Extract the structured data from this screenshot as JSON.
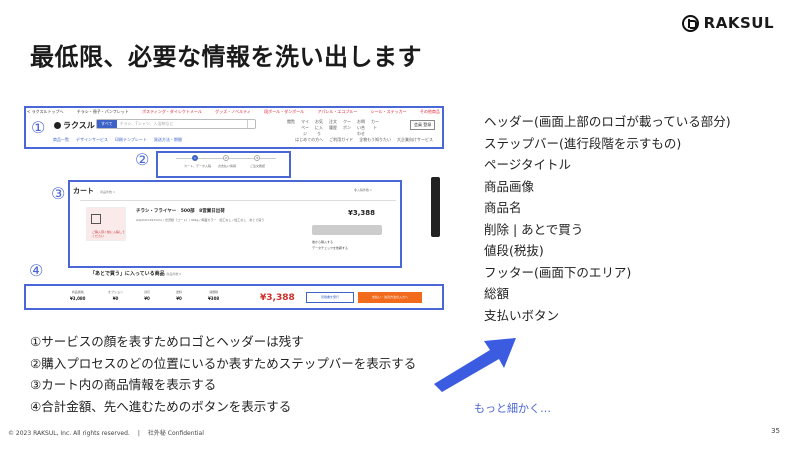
{
  "brand": {
    "name": "RAKSUL"
  },
  "slide": {
    "title": "最低限、必要な情報を洗い出します"
  },
  "mockup": {
    "markers": [
      "①",
      "②",
      "③",
      "④"
    ],
    "topbar_left": "< ラクスルトップへ",
    "topbar_links": [
      "チラシ・冊子・パンフレット",
      "ポスティング・ダイレクトメール",
      "グッズ・ノベルティ",
      "段ボール・ダンボール",
      "アパレル・エコブルー",
      "シール・ステッカー",
      "その他商品"
    ],
    "logo_text": "ラクスル",
    "search_button": "すべて",
    "search_placeholder": "チラシ、Tシャツ、入浴剤など",
    "header_icons": [
      "閲覧",
      "マイページ",
      "お気に入り",
      "注文履歴",
      "クーポン",
      "お問い合わせ",
      "カート"
    ],
    "login": "会員 登録",
    "nav_left": [
      "商品一覧",
      "デザインサービス",
      "印刷テンプレート",
      "発送方法・期間"
    ],
    "nav_right": [
      "はじめての方へ",
      "ご利用ガイド",
      "全物もう知りたい",
      "大企業向けサービス"
    ],
    "steps": [
      {
        "n": "1",
        "label": "カート、データ入稿"
      },
      {
        "n": "2",
        "label": "お支払い情報"
      },
      {
        "n": "3",
        "label": "ご注文確認"
      }
    ],
    "cart_title": "カート",
    "cart_count": "商品件数 1",
    "cart_right": "非入稿件数 1",
    "item_image_text": "ご購入頂く前に入稿してください",
    "item_name": "チラシ・フライヤー　500部　8営業日出荷",
    "item_desc": "A4(210×297mm) / 光沢紙（コート）/ 90kg / 両面カラー　加工なし / 加工なし　あとで買う",
    "item_price": "¥3,388",
    "item_checks": [
      "後から購入する",
      "データチェックを依頼する"
    ],
    "later_title": "「あとで買う」に入っている商品",
    "later_count": "商品件数 0",
    "footer_fields": [
      {
        "label": "商品価格",
        "value": "¥3,080"
      },
      {
        "label": "オプション",
        "value": "¥0"
      },
      {
        "label": "割引",
        "value": "¥0"
      },
      {
        "label": "送料",
        "value": "¥0"
      },
      {
        "label": "消費税",
        "value": "¥308"
      }
    ],
    "footer_total": "¥3,388",
    "footer_btn_estimate": "見積書を発行",
    "footer_btn_pay": "支払い・決済方法の入力へ"
  },
  "list_items": [
    "ヘッダー(画面上部のロゴが載っている部分)",
    "ステップバー(進行段階を示すもの)",
    "ページタイトル",
    "商品画像",
    "商品名",
    "削除 | あとで買う",
    "値段(税抜)",
    "フッター(画面下のエリア)",
    "総額",
    "支払いボタン"
  ],
  "notes": [
    "①サービスの顔を表すためロゴとヘッダーは残す",
    "②購入プロセスのどの位置にいるか表すためステップバーを表示する",
    "③カート内の商品情報を表示する",
    "④合計金額、先へ進むためのボタンを表示する"
  ],
  "more_link": "もっと細かく…",
  "footer": {
    "copyright": "© 2023 RAKSUL, Inc. All rights reserved.",
    "confidential": "社外秘 Confidential"
  },
  "page_number": "35",
  "colors": {
    "accent_blue": "#4a67d6",
    "arrow_blue": "#3b5be0",
    "total_red": "#d0302a",
    "cta_orange": "#f26b1d"
  }
}
